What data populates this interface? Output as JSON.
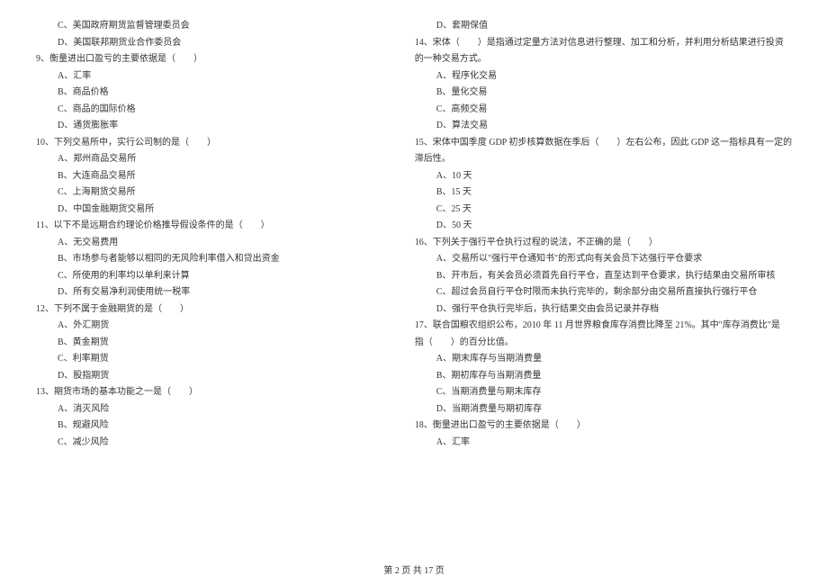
{
  "left": {
    "q8c": "C、美国政府期货监督管理委员会",
    "q8d": "D、美国联邦期货业合作委员会",
    "q9": "9、衡量进出口盈亏的主要依据是（　　）",
    "q9a": "A、汇率",
    "q9b": "B、商品价格",
    "q9c": "C、商品的国际价格",
    "q9d": "D、通货膨胀率",
    "q10": "10、下列交易所中，实行公司制的是（　　）",
    "q10a": "A、郑州商品交易所",
    "q10b": "B、大连商品交易所",
    "q10c": "C、上海期货交易所",
    "q10d": "D、中国金融期货交易所",
    "q11": "11、以下不是远期合约理论价格推导假设条件的是（　　）",
    "q11a": "A、无交易费用",
    "q11b": "B、市场参与者能够以相同的无风险利率借入和贷出资金",
    "q11c": "C、所使用的利率均以单利来计算",
    "q11d": "D、所有交易净利润使用统一税率",
    "q12": "12、下列不属于金融期货的是（　　）",
    "q12a": "A、外汇期货",
    "q12b": "B、黄金期货",
    "q12c": "C、利率期货",
    "q12d": "D、股指期货",
    "q13": "13、期货市场的基本功能之一是（　　）",
    "q13a": "A、消灭风险",
    "q13b": "B、规避风险",
    "q13c": "C、减少风险"
  },
  "right": {
    "q13d": "D、套期保值",
    "q14": "14、宋体（　　）是指通过定量方法对信息进行整理、加工和分析，并利用分析结果进行投资",
    "q14_cont": "的一种交易方式。",
    "q14a": "A、程序化交易",
    "q14b": "B、量化交易",
    "q14c": "C、高频交易",
    "q14d": "D、算法交易",
    "q15": "15、宋体中国季度 GDP 初步核算数据在季后（　　）左右公布，因此 GDP 这一指标具有一定的",
    "q15_cont": "滞后性。",
    "q15a": "A、10 天",
    "q15b": "B、15 天",
    "q15c": "C、25 天",
    "q15d": "D、50 天",
    "q16": "16、下列关于强行平仓执行过程的说法，不正确的是（　　）",
    "q16a": "A、交易所以\"强行平仓通知书\"的形式向有关会员下达强行平仓要求",
    "q16b": "B、开市后，有关会员必须首先自行平仓，直至达到平仓要求，执行结果由交易所审核",
    "q16c": "C、超过会员自行平仓时限而未执行完毕的，剩余部分由交易所直接执行强行平仓",
    "q16d": "D、强行平仓执行完毕后，执行结果交由会员记录并存档",
    "q17": "17、联合国粮农组织公布，2010 年 11 月世界粮食库存消费比降至 21%。其中\"库存消费比\"是",
    "q17_cont": "指（　　）的百分比值。",
    "q17a": "A、期末库存与当期消费量",
    "q17b": "B、期初库存与当期消费量",
    "q17c": "C、当期消费量与期末库存",
    "q17d": "D、当期消费量与期初库存",
    "q18": "18、衡量进出口盈亏的主要依据是（　　）",
    "q18a": "A、汇率"
  },
  "footer": "第 2 页 共 17 页"
}
